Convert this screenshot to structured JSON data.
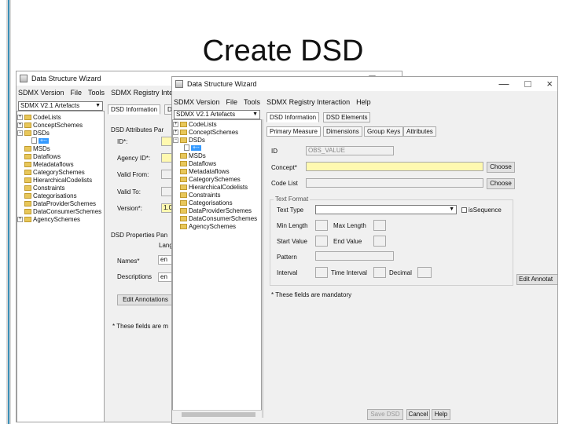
{
  "slide": {
    "title": "Create DSD"
  },
  "back_window": {
    "title": "Data Structure Wizard",
    "menu": [
      "SDMX Version",
      "File",
      "Tools",
      "SDMX Registry Intera"
    ],
    "artefacts_select": "SDMX V2.1 Artefacts",
    "tree": [
      "CodeLists",
      "ConceptSchemes",
      "DSDs",
      "+--",
      "MSDs",
      "Dataflows",
      "Metadataflows",
      "CategorySchemes",
      "HierarchicalCodelists",
      "Constraints",
      "Categorisations",
      "DataProviderSchemes",
      "DataConsumerSchemes",
      "AgencySchemes"
    ],
    "tabs": [
      "DSD Information",
      "D"
    ],
    "attributes_panel": "DSD Attributes Par",
    "fields": {
      "id": "ID*:",
      "agency_id": "Agency ID*:",
      "valid_from": "Valid From:",
      "valid_to": "Valid To:",
      "version": "Version*:",
      "version_value": "1.0"
    },
    "properties_panel": "DSD Properties Pan",
    "lang": "Lang",
    "names_label": "Names*",
    "names_lang": "en",
    "descriptions_label": "Descriptions",
    "descriptions_lang": "en",
    "edit_annotations": "Edit Annotations",
    "mandatory_note": "* These fields are m",
    "window_controls": [
      "□",
      "×"
    ]
  },
  "front_window": {
    "title": "Data Structure Wizard",
    "window_controls": [
      "—",
      "□",
      "×"
    ],
    "menu": [
      "SDMX Version",
      "File",
      "Tools",
      "SDMX Registry Interaction",
      "Help"
    ],
    "artefacts_select": "SDMX V2.1 Artefacts",
    "tree": [
      "CodeLists",
      "ConceptSchemes",
      "DSDs",
      "+--",
      "MSDs",
      "Dataflows",
      "Metadataflows",
      "CategorySchemes",
      "HierarchicalCodelists",
      "Constraints",
      "Categorisations",
      "DataProviderSchemes",
      "DataConsumerSchemes",
      "AgencySchemes"
    ],
    "top_tabs": [
      "DSD Information",
      "DSD Elements"
    ],
    "sub_tabs": [
      "Primary Measure",
      "Dimensions",
      "Group Keys",
      "Attributes"
    ],
    "id_label": "ID",
    "id_value": "OBS_VALUE",
    "concept_label": "Concept*",
    "codelist_label": "Code List",
    "choose_label": "Choose",
    "text_format": {
      "title": "Text Format",
      "text_type": "Text Type",
      "is_sequence": "isSequence",
      "min_length": "Min Length",
      "max_length": "Max Length",
      "start_value": "Start Value",
      "end_value": "End  Value",
      "pattern": "Pattern",
      "interval": "Interval",
      "time_interval": "Time Interval",
      "decimal": "Decimal"
    },
    "edit_annotations": "Edit Annotat",
    "mandatory_note": "* These fields are mandatory",
    "buttons": {
      "save": "Save DSD",
      "cancel": "Cancel",
      "help": "Help"
    }
  }
}
